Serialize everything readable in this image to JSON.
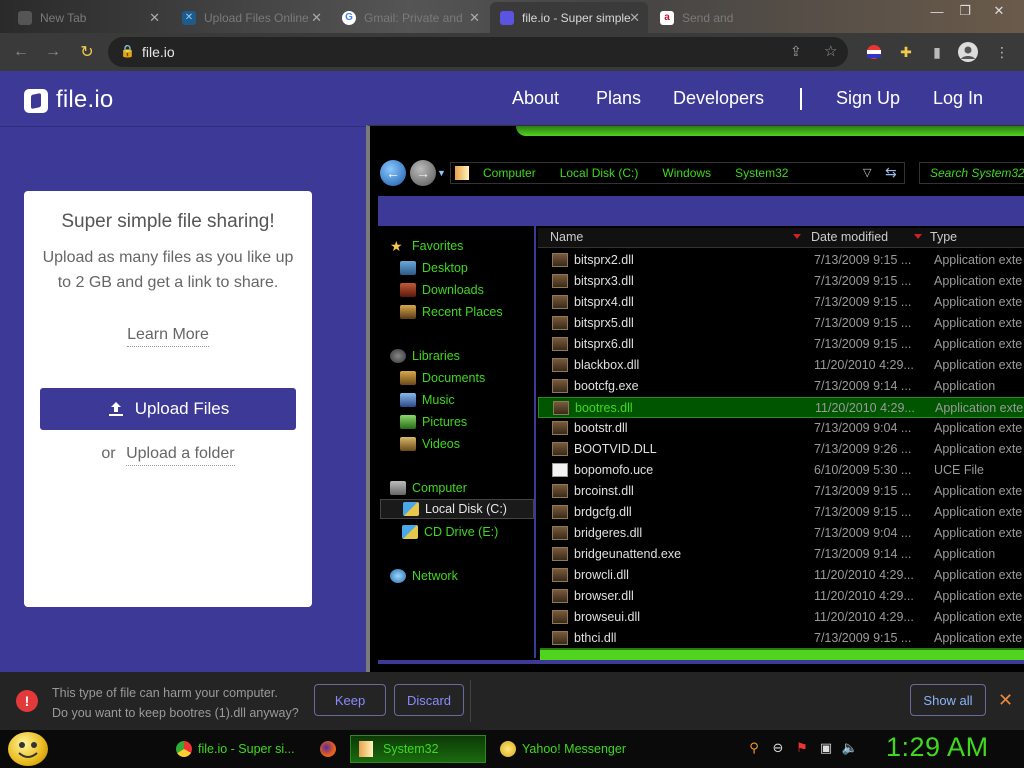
{
  "browser": {
    "tabs": [
      {
        "label": "New Tab",
        "favicon": "new-tab",
        "color": "#888"
      },
      {
        "label": "Upload Files Online",
        "favicon": "x-icon",
        "color": "#4aa3df"
      },
      {
        "label": "Gmail: Private and",
        "favicon": "google-g",
        "color": "#ffffff"
      },
      {
        "label": "file.io - Super simple",
        "favicon": "file-io",
        "color": "#5b54e0"
      },
      {
        "label": "Send and",
        "favicon": "a-icon",
        "color": "#c8102e"
      }
    ],
    "url": "file.io"
  },
  "site": {
    "logo": "file.io",
    "nav": {
      "about": "About",
      "plans": "Plans",
      "developers": "Developers",
      "signup": "Sign Up",
      "login": "Log In"
    },
    "card": {
      "title": "Super simple file sharing!",
      "desc": "Upload as many files as you like up to 2 GB and get a link to share.",
      "learn_more": "Learn More",
      "upload_files": "Upload Files",
      "or": "or",
      "upload_folder": "Upload a folder"
    },
    "brand_color": "#3d3a97"
  },
  "explorer": {
    "breadcrumbs": [
      "Computer",
      "Local Disk (C:)",
      "Windows",
      "System32"
    ],
    "search_placeholder": "Search System32",
    "nav": {
      "favorites": "Favorites",
      "desktop": "Desktop",
      "downloads": "Downloads",
      "recent": "Recent Places",
      "libraries": "Libraries",
      "documents": "Documents",
      "music": "Music",
      "pictures": "Pictures",
      "videos": "Videos",
      "computer": "Computer",
      "local_disk": "Local Disk (C:)",
      "cd_drive": "CD Drive (E:)",
      "network": "Network"
    },
    "columns": {
      "name": "Name",
      "date": "Date modified",
      "type": "Type"
    },
    "files": [
      {
        "name": "bitsprx2.dll",
        "date": "7/13/2009 9:15 ...",
        "type": "Application exte"
      },
      {
        "name": "bitsprx3.dll",
        "date": "7/13/2009 9:15 ...",
        "type": "Application exte"
      },
      {
        "name": "bitsprx4.dll",
        "date": "7/13/2009 9:15 ...",
        "type": "Application exte"
      },
      {
        "name": "bitsprx5.dll",
        "date": "7/13/2009 9:15 ...",
        "type": "Application exte"
      },
      {
        "name": "bitsprx6.dll",
        "date": "7/13/2009 9:15 ...",
        "type": "Application exte"
      },
      {
        "name": "blackbox.dll",
        "date": "11/20/2010 4:29...",
        "type": "Application exte"
      },
      {
        "name": "bootcfg.exe",
        "date": "7/13/2009 9:14 ...",
        "type": "Application"
      },
      {
        "name": "bootres.dll",
        "date": "11/20/2010 4:29...",
        "type": "Application exte"
      },
      {
        "name": "bootstr.dll",
        "date": "7/13/2009 9:04 ...",
        "type": "Application exte"
      },
      {
        "name": "BOOTVID.DLL",
        "date": "7/13/2009 9:26 ...",
        "type": "Application exte"
      },
      {
        "name": "bopomofo.uce",
        "date": "6/10/2009 5:30 ...",
        "type": "UCE File"
      },
      {
        "name": "brcoinst.dll",
        "date": "7/13/2009 9:15 ...",
        "type": "Application exte"
      },
      {
        "name": "brdgcfg.dll",
        "date": "7/13/2009 9:15 ...",
        "type": "Application exte"
      },
      {
        "name": "bridgeres.dll",
        "date": "7/13/2009 9:04 ...",
        "type": "Application exte"
      },
      {
        "name": "bridgeunattend.exe",
        "date": "7/13/2009 9:14 ...",
        "type": "Application"
      },
      {
        "name": "browcli.dll",
        "date": "11/20/2010 4:29...",
        "type": "Application exte"
      },
      {
        "name": "browser.dll",
        "date": "11/20/2010 4:29...",
        "type": "Application exte"
      },
      {
        "name": "browseui.dll",
        "date": "11/20/2010 4:29...",
        "type": "Application exte"
      },
      {
        "name": "bthci.dll",
        "date": "7/13/2009 9:15 ...",
        "type": "Application exte"
      }
    ],
    "selected_file": "bootres.dll",
    "accent": "#3fd81f"
  },
  "download_bar": {
    "warning_line1": "This type of file can harm your computer.",
    "warning_line2": "Do you want to keep bootres (1).dll anyway?",
    "keep": "Keep",
    "discard": "Discard",
    "show_all": "Show all"
  },
  "taskbar": {
    "items": [
      {
        "label": "file.io - Super si...",
        "icon": "chrome-icon"
      },
      {
        "label": "",
        "icon": "firefox-icon"
      },
      {
        "label": "System32",
        "icon": "folder-icon"
      },
      {
        "label": "Yahoo! Messenger",
        "icon": "yahoo-messenger-icon"
      }
    ],
    "clock": "1:29 AM"
  }
}
